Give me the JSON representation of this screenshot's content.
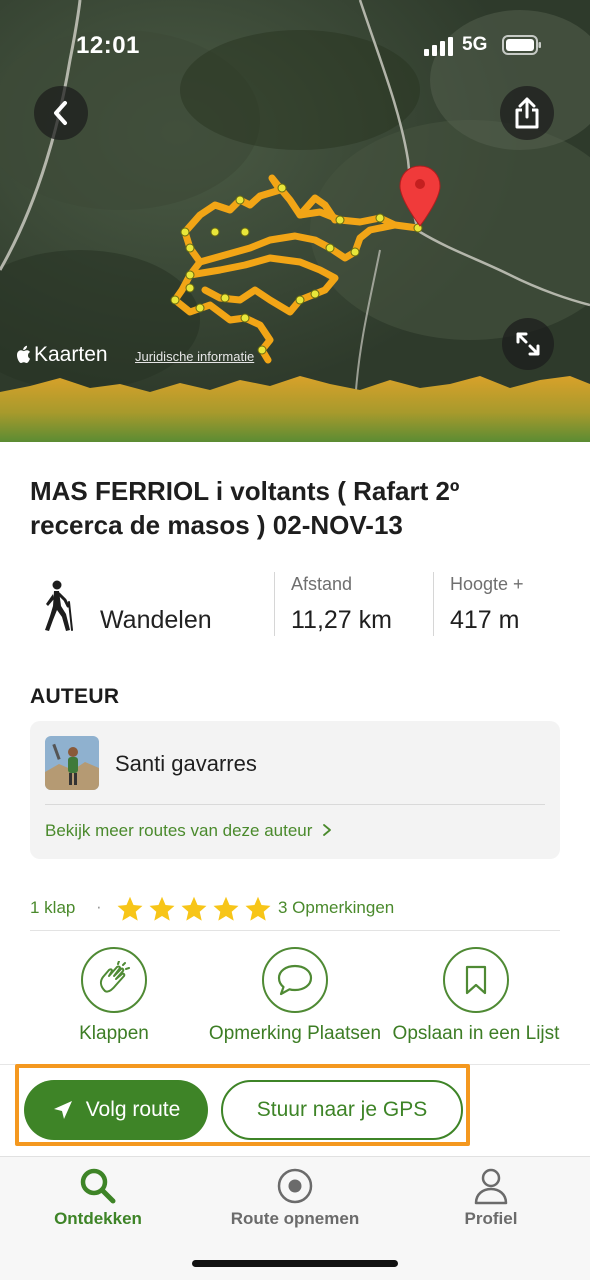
{
  "status_bar": {
    "time": "12:01",
    "network": "5G"
  },
  "map": {
    "brand": "Kaarten",
    "legal_link": "Juridische informatie",
    "icons": {
      "back": "chevron-left-icon",
      "share": "share-icon",
      "expand": "expand-icon",
      "pin": "map-pin-icon"
    },
    "route_color": "#f2a516",
    "elevation_fill": "#d4a12a"
  },
  "route": {
    "title": "MAS FERRIOL i voltants ( Rafart 2º recerca de masos ) 02-NOV-13",
    "activity": "Wandelen",
    "distance_label": "Afstand",
    "distance_value": "11,27 km",
    "elevation_label": "Hoogte +",
    "elevation_value": "417 m"
  },
  "author": {
    "heading": "AUTEUR",
    "name": "Santi gavarres",
    "more_routes_link": "Bekijk meer routes van deze auteur",
    "icons": {
      "chevron": "chevron-right-icon"
    }
  },
  "engagement": {
    "claps": "1 klap",
    "separator": "·",
    "rating": 5,
    "comments": "3 Opmerkingen",
    "actions": [
      {
        "label": "Klappen",
        "icon": "clap-icon"
      },
      {
        "label": "Opmerking Plaatsen",
        "icon": "comment-icon"
      },
      {
        "label": "Opslaan in een Lijst",
        "icon": "bookmark-icon"
      }
    ]
  },
  "cta": {
    "follow_label": "Volg route",
    "gps_label": "Stuur naar je GPS",
    "highlight_color": "#f4981f",
    "primary_color": "#3e8427"
  },
  "tabbar": {
    "tabs": [
      {
        "label": "Ontdekken",
        "icon": "search-icon",
        "active": true
      },
      {
        "label": "Route opnemen",
        "icon": "record-icon",
        "active": false
      },
      {
        "label": "Profiel",
        "icon": "person-icon",
        "active": false
      }
    ]
  }
}
